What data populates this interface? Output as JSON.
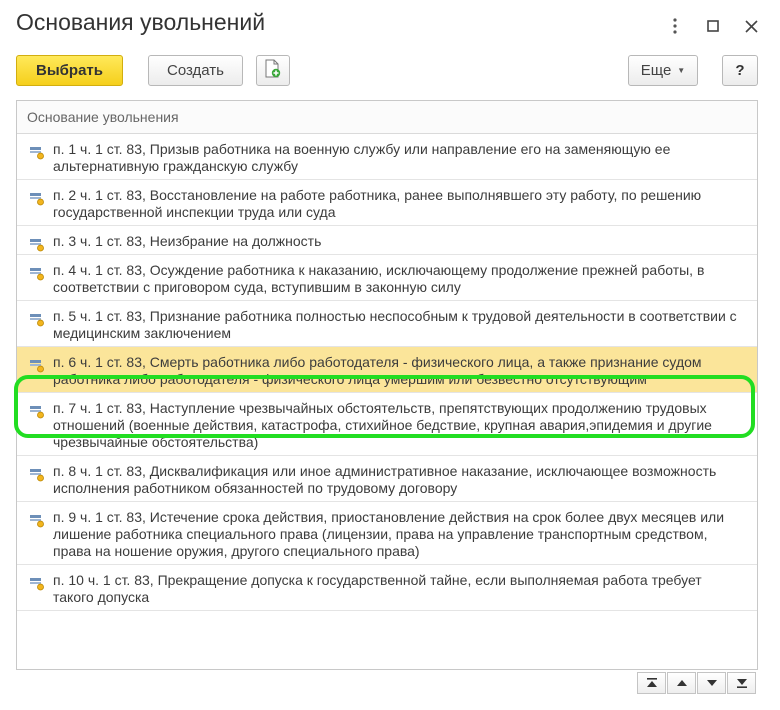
{
  "window": {
    "title": "Основания увольнений"
  },
  "toolbar": {
    "select_label": "Выбрать",
    "create_label": "Создать",
    "more_label": "Еще",
    "help_label": "?"
  },
  "list": {
    "column_header": "Основание увольнения",
    "selected_index": 5,
    "rows": [
      {
        "text": "п. 1 ч. 1 ст. 83, Призыв работника на военную службу или направление его на заменяющую ее альтернативную гражданскую службу"
      },
      {
        "text": "п. 2 ч. 1 ст. 83, Восстановление на работе работника, ранее выполнявшего эту работу, по решению государственной инспекции труда или суда"
      },
      {
        "text": "п. 3 ч. 1 ст. 83, Неизбрание на должность"
      },
      {
        "text": "п. 4 ч. 1 ст. 83, Осуждение работника к наказанию, исключающему продолжение прежней работы, в соответствии с приговором суда, вступившим в законную силу"
      },
      {
        "text": "п. 5 ч. 1 ст. 83, Признание работника полностью неспособным к трудовой деятельности в соответствии с медицинским заключением"
      },
      {
        "text": "п. 6 ч. 1 ст. 83, Смерть работника либо работодателя - физического лица, а также признание судом работника либо работодателя - физического лица умершим или безвестно отсутствующим"
      },
      {
        "text": "п. 7 ч. 1 ст. 83, Наступление чрезвычайных обстоятельств, препятствующих продолжению трудовых отношений (военные действия, катастрофа, стихийное бедствие, крупная авария,эпидемия и другие чрезвычайные обстоятельства)"
      },
      {
        "text": "п. 8 ч. 1 ст. 83, Дисквалификация или иное административное наказание, исключающее возможность исполнения работником обязанностей по трудовому договору"
      },
      {
        "text": "п. 9 ч. 1 ст. 83, Истечение срока действия, приостановление действия на срок более двух месяцев или лишение работника специального права (лицензии, права на управление транспортным средством, права на ношение оружия, другого специального права)"
      },
      {
        "text": "п. 10 ч. 1 ст. 83, Прекращение допуска к государственной тайне, если выполняемая работа требует такого допуска"
      }
    ]
  },
  "icons": {
    "row_item": "catalog-item-icon",
    "copy": "add-copy-icon",
    "menu": "more-vert-icon",
    "maximize": "maximize-icon",
    "close": "close-icon"
  },
  "colors": {
    "primary_button": "#f5cf1b",
    "selected_row": "#fbe59a",
    "highlight_frame": "#22dd22"
  }
}
